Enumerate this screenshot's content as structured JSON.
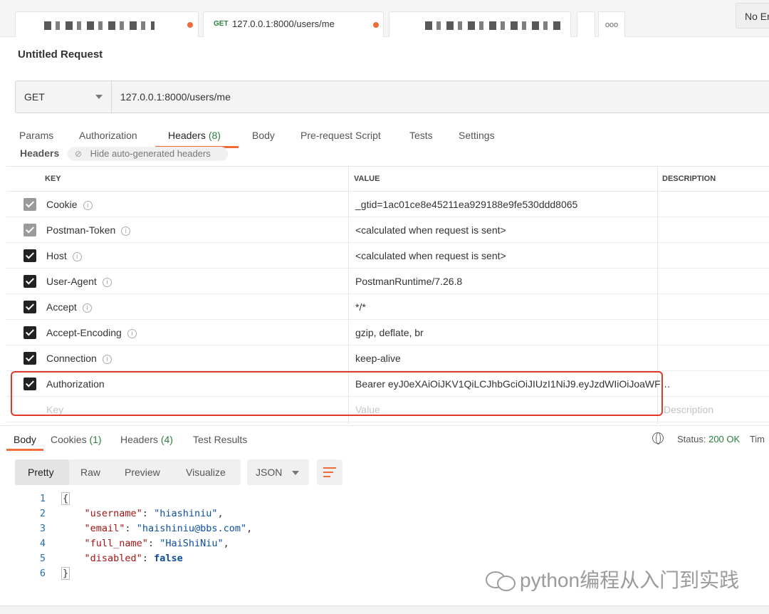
{
  "tabs": [
    {
      "label": "",
      "blurred": true
    },
    {
      "method": "GET",
      "label": "127.0.0.1:8000/users/me",
      "active": true
    },
    {
      "label": "",
      "blurred": true
    }
  ],
  "more_tabs_label": "ooo",
  "environment": "No En",
  "request_title": "Untitled Request",
  "url_bar": {
    "method": "GET",
    "url": "127.0.0.1:8000/users/me"
  },
  "request_tabs": [
    {
      "label": "Params"
    },
    {
      "label": "Authorization"
    },
    {
      "label": "Headers",
      "count": "(8)",
      "active": true
    },
    {
      "label": "Body"
    },
    {
      "label": "Pre-request Script"
    },
    {
      "label": "Tests"
    },
    {
      "label": "Settings"
    }
  ],
  "headers_section": {
    "label": "Headers",
    "hide_toggle": "Hide auto-generated headers"
  },
  "table": {
    "columns": [
      "KEY",
      "VALUE",
      "DESCRIPTION"
    ],
    "rows": [
      {
        "key": "Cookie",
        "value": "_gtid=1ac01ce8e45211ea929188e9fe530ddd8065",
        "checked": true,
        "auto": true,
        "info": true
      },
      {
        "key": "Postman-Token",
        "value": "<calculated when request is sent>",
        "checked": true,
        "auto": true,
        "info": true
      },
      {
        "key": "Host",
        "value": "<calculated when request is sent>",
        "checked": true,
        "auto": false,
        "info": true
      },
      {
        "key": "User-Agent",
        "value": "PostmanRuntime/7.26.8",
        "checked": true,
        "auto": false,
        "info": true
      },
      {
        "key": "Accept",
        "value": "*/*",
        "checked": true,
        "auto": false,
        "info": true
      },
      {
        "key": "Accept-Encoding",
        "value": "gzip, deflate, br",
        "checked": true,
        "auto": false,
        "info": true
      },
      {
        "key": "Connection",
        "value": "keep-alive",
        "checked": true,
        "auto": false,
        "info": true
      },
      {
        "key": "Authorization",
        "value": "Bearer eyJ0eXAiOiJKV1QiLCJhbGciOiJIUzI1NiJ9.eyJzdWIiOiJoaWF…",
        "checked": true,
        "auto": false,
        "info": false
      }
    ],
    "placeholders": {
      "key": "Key",
      "value": "Value",
      "description": "Description"
    }
  },
  "response_tabs": [
    {
      "label": "Body",
      "active": true
    },
    {
      "label": "Cookies",
      "count": "(1)"
    },
    {
      "label": "Headers",
      "count": "(4)"
    },
    {
      "label": "Test Results"
    }
  ],
  "status": {
    "label": "Status:",
    "code": "200 OK",
    "time_label": "Tim"
  },
  "view_modes": [
    "Pretty",
    "Raw",
    "Preview",
    "Visualize"
  ],
  "format": "JSON",
  "response_lines": [
    {
      "n": "1",
      "text": "{"
    },
    {
      "n": "2",
      "key": "\"username\"",
      "value": "\"hiashiniu\"",
      "comma": ","
    },
    {
      "n": "3",
      "key": "\"email\"",
      "value": "\"haishiniu@bbs.com\"",
      "comma": ","
    },
    {
      "n": "4",
      "key": "\"full_name\"",
      "value": "\"HaiShiNiu\"",
      "comma": ","
    },
    {
      "n": "5",
      "key": "\"disabled\"",
      "value": "false",
      "comma": ""
    },
    {
      "n": "6",
      "text": "}"
    }
  ],
  "watermark": "python编程从入门到实践",
  "colors": {
    "accent": "#f26b3a",
    "success": "#2a7f3e",
    "highlight_box": "#e23a2a"
  }
}
